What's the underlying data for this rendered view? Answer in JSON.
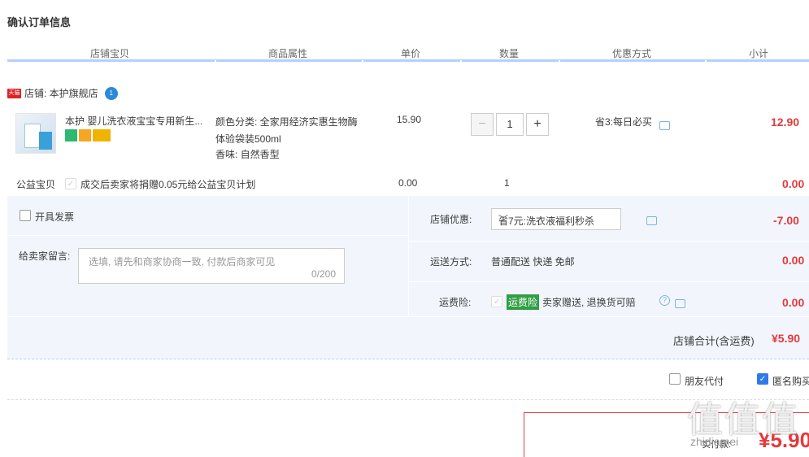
{
  "page_title": "确认订单信息",
  "table_headers": [
    "店铺宝贝",
    "商品属性",
    "单价",
    "数量",
    "优惠方式",
    "小计"
  ],
  "shop": {
    "tag": "天猫",
    "label": "店铺: 本护旗舰店",
    "ww": "1"
  },
  "item": {
    "title": "本护 婴儿洗衣液宝宝专用新生...",
    "attr1": "颜色分类: 全家用经济实惠生物酶",
    "attr2": "体验袋装500ml",
    "attr3": "香味: 自然香型",
    "price": "15.90",
    "quantity": "1",
    "minus": "−",
    "plus": "+",
    "promo": "省3:每日必买",
    "subtotal": "12.90"
  },
  "charity": {
    "label": "公益宝贝",
    "check": "✓",
    "text": "成交后卖家将捐赠0.05元给公益宝贝计划",
    "price": "0.00",
    "qty": "1",
    "subtotal": "0.00"
  },
  "invoice": {
    "label": "开具发票"
  },
  "message": {
    "label": "给卖家留言:",
    "placeholder": "选填, 请先和商家协商一致, 付款后商家可见",
    "count": "0/200"
  },
  "shop_discount": {
    "label": "店铺优惠:",
    "selected": "省7元:洗衣液福利秒杀",
    "arrow": "﹀",
    "amount": "-7.00"
  },
  "shipping": {
    "label": "运送方式:",
    "value": "普通配送 快递 免邮",
    "amount": "0.00"
  },
  "insurance": {
    "label": "运费险:",
    "check": "✓",
    "tag": "运费险",
    "text": "卖家赠送, 退换货可赔",
    "help": "?",
    "amount": "0.00"
  },
  "shop_total": {
    "label": "店铺合计(含运费)",
    "amount": "¥5.90"
  },
  "options": {
    "friend_pay": "朋友代付",
    "anonymous": "匿名购买",
    "check": "✓"
  },
  "pay": {
    "label": "实付款:",
    "amount": "¥5.90"
  },
  "watermark": {
    "big": "值值值",
    "small": "zhidiamei"
  },
  "colors": {
    "accent_red": "#e4393c",
    "header_line": "#b2d1ff",
    "panel_bg": "#f2f6fc"
  }
}
